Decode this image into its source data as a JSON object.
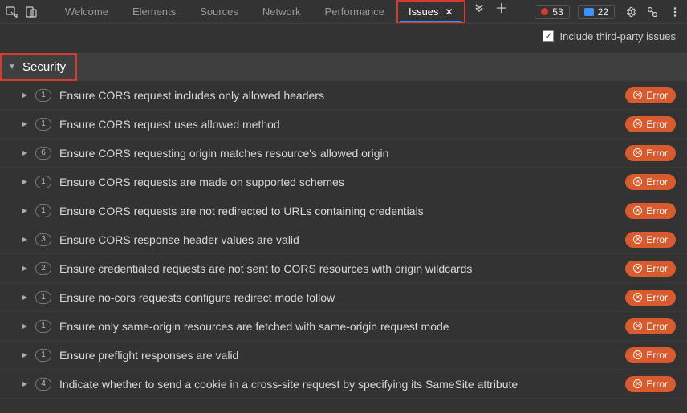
{
  "tabs": {
    "items": [
      {
        "label": "Welcome"
      },
      {
        "label": "Elements"
      },
      {
        "label": "Sources"
      },
      {
        "label": "Network"
      },
      {
        "label": "Performance"
      },
      {
        "label": "Issues",
        "active": true
      }
    ]
  },
  "counters": {
    "errors": "53",
    "messages": "22"
  },
  "secondary": {
    "include_third_party_label": "Include third-party issues",
    "include_third_party_checked": true
  },
  "category": {
    "label": "Security"
  },
  "issues": [
    {
      "count": "1",
      "title": "Ensure CORS request includes only allowed headers",
      "severity": "Error"
    },
    {
      "count": "1",
      "title": "Ensure CORS request uses allowed method",
      "severity": "Error"
    },
    {
      "count": "6",
      "title": "Ensure CORS requesting origin matches resource's allowed origin",
      "severity": "Error"
    },
    {
      "count": "1",
      "title": "Ensure CORS requests are made on supported schemes",
      "severity": "Error"
    },
    {
      "count": "1",
      "title": "Ensure CORS requests are not redirected to URLs containing credentials",
      "severity": "Error"
    },
    {
      "count": "3",
      "title": "Ensure CORS response header values are valid",
      "severity": "Error"
    },
    {
      "count": "2",
      "title": "Ensure credentialed requests are not sent to CORS resources with origin wildcards",
      "severity": "Error"
    },
    {
      "count": "1",
      "title": "Ensure no-cors requests configure redirect mode follow",
      "severity": "Error"
    },
    {
      "count": "1",
      "title": "Ensure only same-origin resources are fetched with same-origin request mode",
      "severity": "Error"
    },
    {
      "count": "1",
      "title": "Ensure preflight responses are valid",
      "severity": "Error"
    },
    {
      "count": "4",
      "title": "Indicate whether to send a cookie in a cross-site request by specifying its SameSite attribute",
      "severity": "Error"
    }
  ]
}
